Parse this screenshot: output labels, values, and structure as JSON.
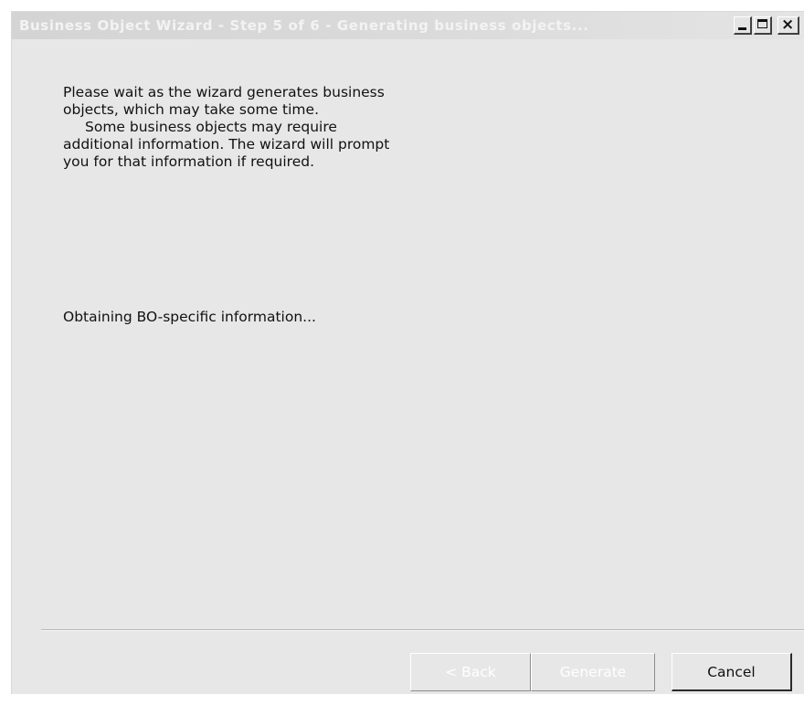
{
  "window": {
    "title": "Business Object Wizard - Step 5 of 6 - Generating business objects..."
  },
  "titlebar_buttons": {
    "minimize_icon": "minimize-icon",
    "maximize_icon": "maximize-icon",
    "close_icon": "close-icon",
    "close_glyph": "×"
  },
  "message": {
    "line1": "Please wait as the wizard generates business objects, which may take some time.",
    "line2": "Some business objects may require additional information. The wizard will prompt you for that information if required."
  },
  "status": {
    "text": "Obtaining BO-specific information..."
  },
  "buttons": {
    "back_label": "< Back",
    "generate_label": "Generate",
    "cancel_label": "Cancel"
  },
  "colors": {
    "background": "#e7e7e7",
    "title_text": "#f3f3f3",
    "disabled_text": "#ffffff"
  }
}
